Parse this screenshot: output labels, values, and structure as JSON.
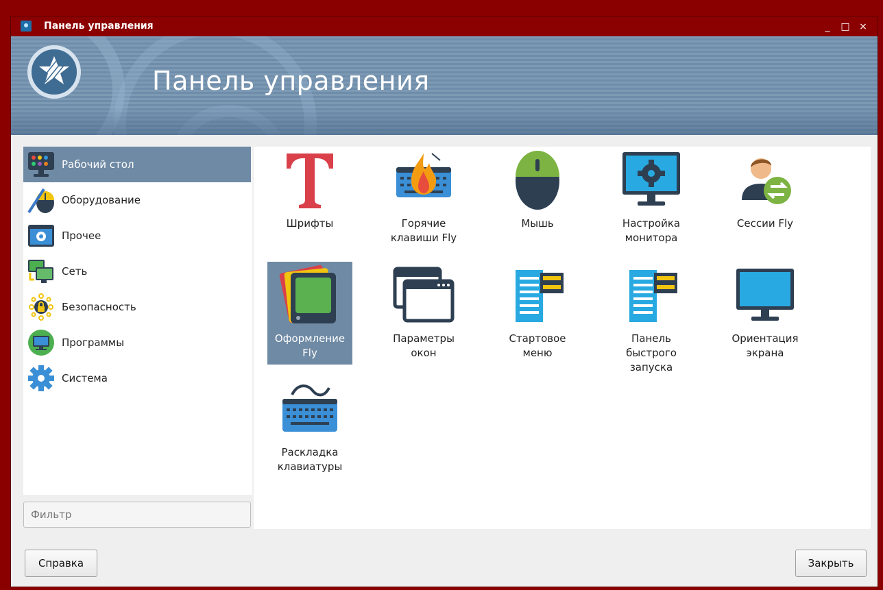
{
  "window": {
    "title": "Панель управления",
    "controls": [
      "_",
      "□",
      "×"
    ]
  },
  "banner": {
    "title": "Панель управления"
  },
  "sidebar": {
    "items": [
      {
        "label": "Рабочий стол",
        "icon": "desktop-palette-icon",
        "selected": true
      },
      {
        "label": "Оборудование",
        "icon": "hardware-mouse-pen-icon",
        "selected": false
      },
      {
        "label": "Прочее",
        "icon": "other-gear-window-icon",
        "selected": false
      },
      {
        "label": "Сеть",
        "icon": "network-monitors-icon",
        "selected": false
      },
      {
        "label": "Безопасность",
        "icon": "security-lock-icon",
        "selected": false
      },
      {
        "label": "Программы",
        "icon": "programs-monitor-icon",
        "selected": false
      },
      {
        "label": "Система",
        "icon": "system-gear-icon",
        "selected": false
      }
    ]
  },
  "filter": {
    "placeholder": "Фильтр"
  },
  "items": [
    {
      "label": "Шрифты",
      "icon": "fonts-icon"
    },
    {
      "label": "Горячие клавиши Fly",
      "icon": "hotkeys-icon"
    },
    {
      "label": "Мышь",
      "icon": "mouse-icon"
    },
    {
      "label": "Настройка монитора",
      "icon": "monitor-settings-icon"
    },
    {
      "label": "Сессии Fly",
      "icon": "sessions-icon"
    },
    {
      "label": "Оформление Fly",
      "icon": "appearance-icon",
      "selected": true
    },
    {
      "label": "Параметры окон",
      "icon": "window-params-icon"
    },
    {
      "label": "Стартовое меню",
      "icon": "start-menu-icon"
    },
    {
      "label": "Панель быстрого запуска",
      "icon": "quick-launch-icon"
    },
    {
      "label": "Ориентация экрана",
      "icon": "screen-orientation-icon"
    },
    {
      "label": "Раскладка клавиатуры",
      "icon": "keyboard-layout-icon"
    }
  ],
  "buttons": {
    "help": "Справка",
    "close": "Закрыть"
  },
  "colors": {
    "titlebar": "#8b0000",
    "selection": "#6f8aa4",
    "banner": "#7d9ab4"
  }
}
